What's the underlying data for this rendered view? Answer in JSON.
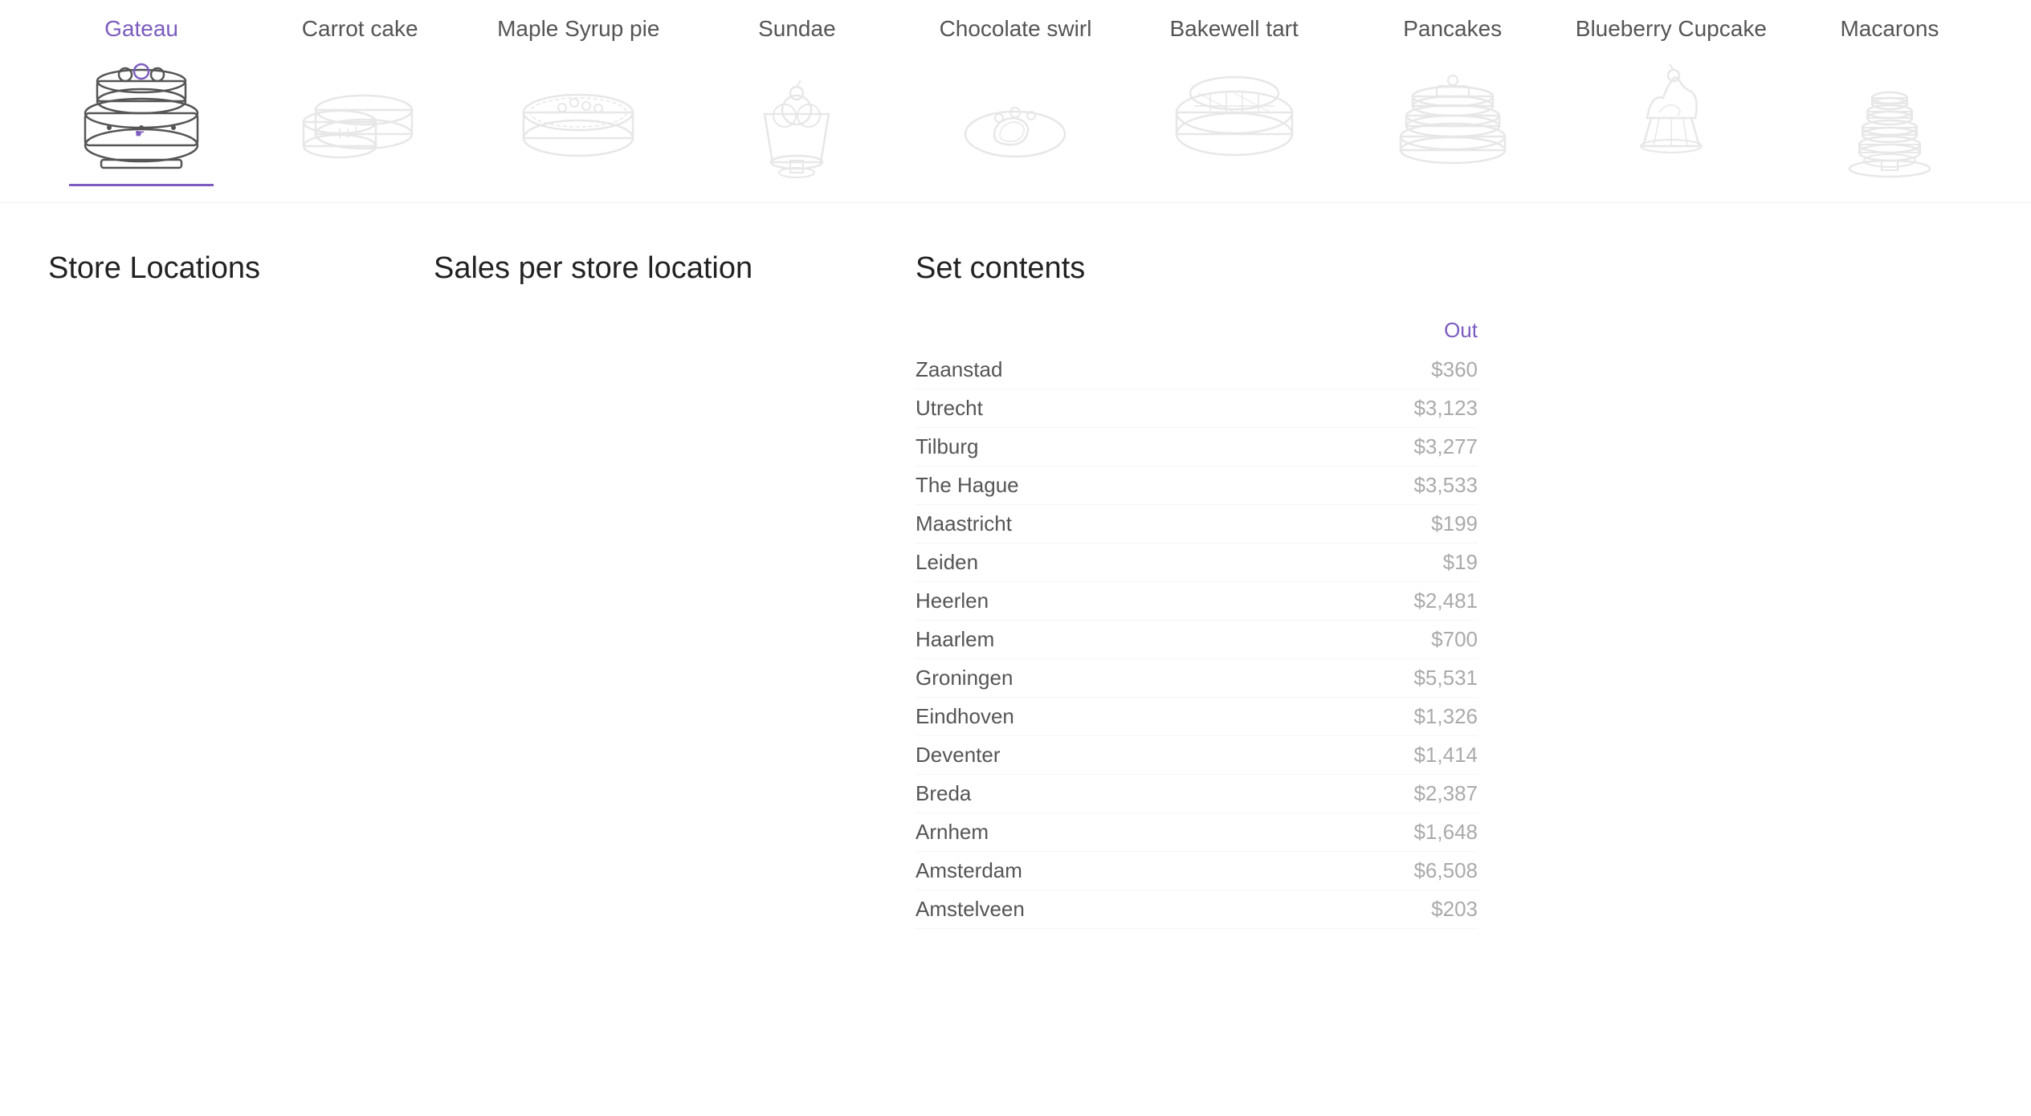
{
  "desserts": [
    {
      "id": "gateau",
      "label": "Gateau",
      "active": true
    },
    {
      "id": "carrot-cake",
      "label": "Carrot cake",
      "active": false
    },
    {
      "id": "maple-syrup-pie",
      "label": "Maple Syrup pie",
      "active": false
    },
    {
      "id": "sundae",
      "label": "Sundae",
      "active": false
    },
    {
      "id": "chocolate-swirl",
      "label": "Chocolate swirl",
      "active": false
    },
    {
      "id": "bakewell-tart",
      "label": "Bakewell tart",
      "active": false
    },
    {
      "id": "pancakes",
      "label": "Pancakes",
      "active": false
    },
    {
      "id": "blueberry-cupcake",
      "label": "Blueberry Cupcake",
      "active": false
    },
    {
      "id": "macarons",
      "label": "Macarons",
      "active": false
    }
  ],
  "sections": {
    "store_locations_title": "Store Locations",
    "sales_title": "Sales per store location",
    "set_contents_title": "Set contents"
  },
  "set_contents": {
    "col_location": "",
    "col_out": "Out",
    "rows": [
      {
        "location": "Zaanstad",
        "value": "$360"
      },
      {
        "location": "Utrecht",
        "value": "$3,123"
      },
      {
        "location": "Tilburg",
        "value": "$3,277"
      },
      {
        "location": "The Hague",
        "value": "$3,533"
      },
      {
        "location": "Maastricht",
        "value": "$199"
      },
      {
        "location": "Leiden",
        "value": "$19"
      },
      {
        "location": "Heerlen",
        "value": "$2,481"
      },
      {
        "location": "Haarlem",
        "value": "$700"
      },
      {
        "location": "Groningen",
        "value": "$5,531"
      },
      {
        "location": "Eindhoven",
        "value": "$1,326"
      },
      {
        "location": "Deventer",
        "value": "$1,414"
      },
      {
        "location": "Breda",
        "value": "$2,387"
      },
      {
        "location": "Arnhem",
        "value": "$1,648"
      },
      {
        "location": "Amsterdam",
        "value": "$6,508"
      },
      {
        "location": "Amstelveen",
        "value": "$203"
      }
    ]
  }
}
